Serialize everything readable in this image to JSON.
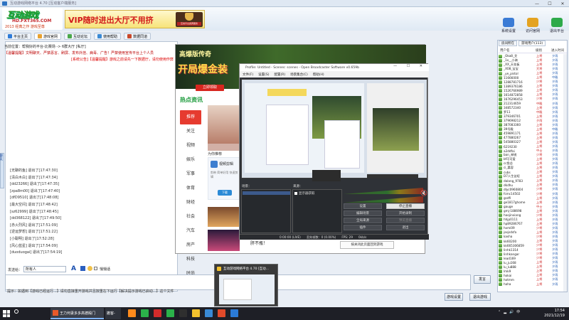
{
  "window": {
    "title": "互动游戏网络平台 4.70 [互动客户端服务]"
  },
  "banner": {
    "logo_main": "互动游戏",
    "logo_site": "HD.FXT365.COM",
    "logo_slogan": "2013 经典之作 游戏至尊",
    "vip_text": "VIP随时进出大厅不用挤",
    "vip_badge": "互动平台贵宾服务"
  },
  "toolbar": [
    {
      "label": "系统设置",
      "color": "#3a7bd5"
    },
    {
      "label": "访问官网",
      "color": "#e4a321"
    },
    {
      "label": "退出平台",
      "color": "#2eaa4a"
    }
  ],
  "navtabs": [
    {
      "label": "平台主页",
      "color": "#2f7bd8"
    },
    {
      "label": "游戏官网",
      "color": "#e9a230"
    },
    {
      "label": "互动论坛",
      "color": "#4aa84a"
    },
    {
      "label": "使用帮助",
      "color": "#3a8ad5"
    },
    {
      "label": "数据同道",
      "color": "#c9482a"
    }
  ],
  "chat": {
    "header1": "当前位置：帮我好的平台-比赛场 -> 6群大厅 [私厅]",
    "header2": "【温馨提醒】文明聊天、严禁恶言、刷屏、发布外挂、病毒、广告！严禁使用宣传平台上个人员",
    "header3": "[系统公告]【温馨提醒】游戏之前请先一下数据厅，请勿使用作弊",
    "joins": [
      "[无聊的鱼] 退出了[17:47:30]",
      "[清白木白] 退出了[17:47:34]",
      "[dd23266] 退出了[17:47:35]",
      "[zpa8m00] 退出了[17:47:40]",
      "[dfD9510] 退出了[17:48:08]",
      "[最大空间] 退出了[17:48:42]",
      "[sz62999] 退出了[17:48:45]",
      "[dd368122] 退出了[17:49:50]",
      "[赤火烈风] 退出了[17:51:09]",
      "[逆运梦想] 退出了[17:51:22]",
      "[小聪明] 退出了[17:52:28]",
      "[风心蓝星] 退出了[17:54:09]",
      "[duoduogai] 退出了[17:54:19]"
    ],
    "side_tab": "聊天"
  },
  "browser": {
    "game_title": "高爆版传奇",
    "game_slogan": "开局爆金装",
    "game_btn": "立即领取",
    "hot_logo": "热点资讯",
    "categories": [
      "推荐",
      "关注",
      "视频",
      "娱乐",
      "军事",
      "体育",
      "财经",
      "社会",
      "汽车",
      "房产",
      "科技",
      "时尚"
    ],
    "recommend_label": "为你推荐",
    "ad_title": "视频剪辑",
    "ad_desc": "剪映 简单好用 快速剪辑",
    "ad_btn": "下载",
    "hot_text": "肝不瓶！"
  },
  "obs": {
    "title": "Profile: Untitled - Scenes: scenes - Open Broadcaster Software v0.659b",
    "menu": [
      "文件(F)",
      "设置(S)",
      "配置(R)",
      "场景集合(C)",
      "帮助(H)"
    ],
    "scenes_label": "场景：",
    "sources_label": "来源：",
    "source_item": "显示器获取",
    "buttons": [
      {
        "label": "设置",
        "light": false,
        "disabled": false
      },
      {
        "label": "停止直播",
        "light": true,
        "disabled": false
      },
      {
        "label": "编辑场景",
        "light": false,
        "disabled": false
      },
      {
        "label": "开始录制",
        "light": false,
        "disabled": false
      },
      {
        "label": "全局来源",
        "light": false,
        "disabled": false
      },
      {
        "label": "预览直播",
        "light": false,
        "disabled": true
      },
      {
        "label": "插件",
        "light": false,
        "disabled": false
      },
      {
        "label": "退出",
        "light": false,
        "disabled": false
      }
    ],
    "status_time": "0:00:00 (LIVE)",
    "status_drop": "丢失帧数：0 (0.00%)",
    "status_fps": "FPS: 29",
    "status_bitrate": "0kb/s",
    "mute_icon": "🔇"
  },
  "toast": "按关闭此页面回到游戏",
  "right": {
    "tabs": [
      "房间所在",
      "游戏用户(113)"
    ],
    "headers": [
      "用户名",
      "级别",
      "进入时间"
    ],
    "users": [
      [
        "_Oka8_艾",
        "上将",
        "夕雨"
      ],
      [
        "_1x__小骑",
        "上将",
        "夕雨"
      ],
      [
        "_XX_天花板",
        "上将",
        "夕雨"
      ],
      [
        "_X08_宝宝",
        "大将",
        "夕雨"
      ],
      [
        "_ye_pistol",
        "上将",
        "夕雨"
      ],
      [
        "11666000",
        "上将",
        "中殿"
      ],
      [
        "1288781716",
        "少将",
        "夕雨"
      ],
      [
        "1389376186",
        "上将",
        "夕雨"
      ],
      [
        "1526766989",
        "上将",
        "夕雨"
      ],
      [
        "1614872858",
        "上将",
        "夕雨"
      ],
      [
        "1676296453",
        "少将",
        "夕雨"
      ],
      [
        "212314659",
        "中殿",
        "夕雨"
      ],
      [
        "348572340",
        "上将",
        "夕雨"
      ],
      [
        "罗11",
        "中殿",
        "夕雨"
      ],
      [
        "379346701",
        "上将",
        "夕雨"
      ],
      [
        "379698212",
        "夕雨",
        "夕雨"
      ],
      [
        "387083360",
        "上将",
        "夕雨"
      ],
      [
        "39号殿",
        "上将",
        "中殿"
      ],
      [
        "459891171",
        "上将",
        "夕雨"
      ],
      [
        "477880267",
        "上将",
        "夕雨"
      ],
      [
        "545880327",
        "上将",
        "夕雨"
      ],
      [
        "6219230",
        "上将",
        "夕雨"
      ],
      [
        "a2ddfai",
        "中士",
        "夕雨"
      ],
      [
        "ban_林锐",
        "少将",
        "夕雨"
      ],
      [
        "bf可可爱",
        "上将",
        "夕雨"
      ],
      [
        "cc鱼总",
        "上将",
        "夕雨"
      ],
      [
        "ci_慕容",
        "上将",
        "夕雨"
      ],
      [
        "cvbs",
        "上将",
        "夕雨"
      ],
      [
        "D7人生苦短",
        "上将",
        "夕雨"
      ],
      [
        "dalang_9783",
        "上将",
        "夕雨"
      ],
      [
        "dkdhu",
        "上将",
        "夕雨"
      ],
      [
        "dlyc0960804",
        "少将",
        "夕雨"
      ],
      [
        "fcmc14502",
        "少将",
        "夕雨"
      ],
      [
        "gsdfi",
        "上将",
        "夕雨"
      ],
      [
        "ge1817ghome",
        "上将",
        "夕雨"
      ],
      [
        "gauge",
        "中士",
        "夕雨"
      ],
      [
        "gmj-188698",
        "上将",
        "夕雨"
      ],
      [
        "haojinxiang",
        "少将",
        "夕雨"
      ],
      [
        "hhjp0111",
        "上将",
        "夕雨"
      ],
      [
        "hp89286767",
        "上将",
        "夕雨"
      ],
      [
        "hxmi09",
        "少将",
        "夕雨"
      ],
      [
        "jasjsdsfa",
        "上将",
        "夕雨"
      ],
      [
        "kasha",
        "少将",
        "夕雨"
      ],
      [
        "kk60200",
        "上将",
        "夕雨"
      ],
      [
        "kk665306859",
        "少将",
        "夕雨"
      ],
      [
        "linhk1314",
        "少将",
        "夕雨"
      ],
      [
        "linhkangar",
        "少将",
        "夕雨"
      ],
      [
        "lead169",
        "少将",
        "夕雨"
      ],
      [
        "lu_ju168",
        "上将",
        "夕雨"
      ],
      [
        "lu_lu888",
        "上将",
        "夕雨"
      ],
      [
        "lmk9",
        "上将",
        "夕雨"
      ],
      [
        "hokai",
        "上将",
        "夕雨"
      ],
      [
        "hotmm",
        "上将",
        "夕雨"
      ],
      [
        "haha",
        "上将",
        "夕雨"
      ]
    ]
  },
  "input": {
    "send_label": "发送给：",
    "send_to": "所有人",
    "private_label": "悄悄话",
    "send_btn": "发言"
  },
  "tip": "提示：如遇到【游戏已经运行...】请勿直接重开游戏并且按重在下运行【解决提示游戏已启动...】这个文件",
  "footer": {
    "settings_btn": "游戏设置",
    "exit_btn": "退出游戏"
  },
  "thumb": {
    "title": "互动游戏网络平台 4.70 [互动..."
  },
  "taskbar": {
    "app1_label": "王力何妻多多高德殿门",
    "app2_label": "撤客-",
    "icons": [
      "#ff8a1c",
      "#2bb24a",
      "#d22b2b",
      "#2bb24a",
      "#2f2f2f",
      "#f2c12e",
      "#3a8ad5",
      "#e24a2a",
      "#2b7bd8"
    ],
    "time": "17:54",
    "date": "2021/12/19"
  }
}
